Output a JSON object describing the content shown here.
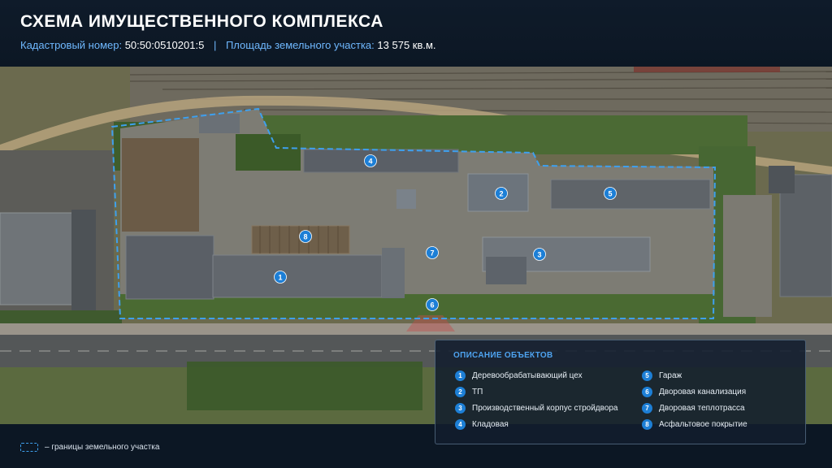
{
  "header": {
    "title": "СХЕМА ИМУЩЕСТВЕННОГО КОМПЛЕКСА",
    "cadastral_label": "Кадастровый номер:",
    "cadastral_value": "50:50:0510201:5",
    "separator": "|",
    "area_label": "Площадь земельного участка:",
    "area_value": "13 575 кв.м."
  },
  "map": {
    "markers": [
      "1",
      "2",
      "3",
      "4",
      "5",
      "6",
      "7",
      "8"
    ],
    "boundary_color": "#3ea0ee",
    "marker_color": "#1d7fd6"
  },
  "legend": {
    "title": "ОПИСАНИЕ ОБЪЕКТОВ",
    "items": [
      {
        "num": "1",
        "label": "Деревообрабатывающий цех"
      },
      {
        "num": "2",
        "label": "ТП"
      },
      {
        "num": "3",
        "label": "Производственный корпус стройдвора"
      },
      {
        "num": "4",
        "label": "Кладовая"
      },
      {
        "num": "5",
        "label": "Гараж"
      },
      {
        "num": "6",
        "label": "Дворовая канализация"
      },
      {
        "num": "7",
        "label": "Дворовая теплотрасса"
      },
      {
        "num": "8",
        "label": "Асфальтовое покрытие"
      }
    ]
  },
  "boundary_note": "– границы земельного участка"
}
